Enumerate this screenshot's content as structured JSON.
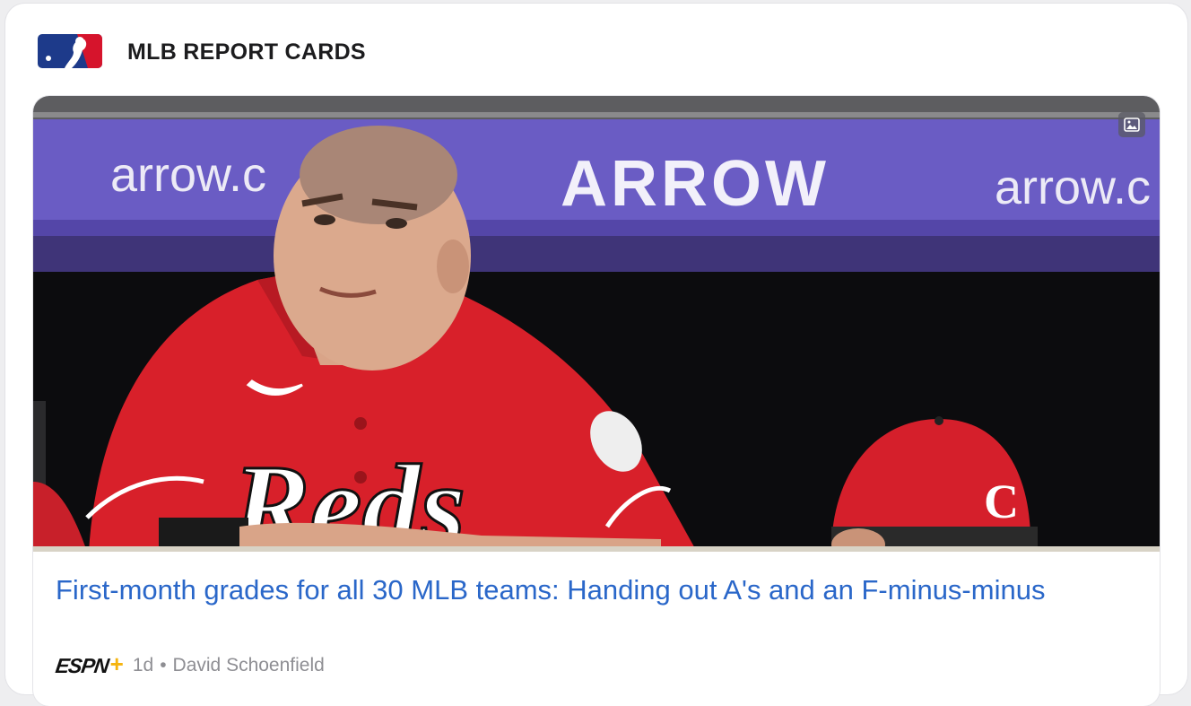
{
  "section": {
    "title": "MLB REPORT CARDS",
    "logo_icon": "mlb-logo-icon"
  },
  "story": {
    "photo_banner_texts": [
      "arrow.c",
      "ARROW",
      "arrow.c"
    ],
    "jersey_text": "Reds",
    "headline": "First-month grades for all 30 MLB teams: Handing out A's and an F-minus-minus",
    "source": "ESPN",
    "source_plus": "+",
    "age": "1d",
    "separator": "•",
    "author": "David Schoenfield",
    "photo_badge_icon": "image-icon"
  },
  "colors": {
    "headline": "#2a67c9",
    "banner_purple": "#6a5cc4",
    "jersey_red": "#d8202a",
    "espn_plus": "#f5b40f"
  }
}
